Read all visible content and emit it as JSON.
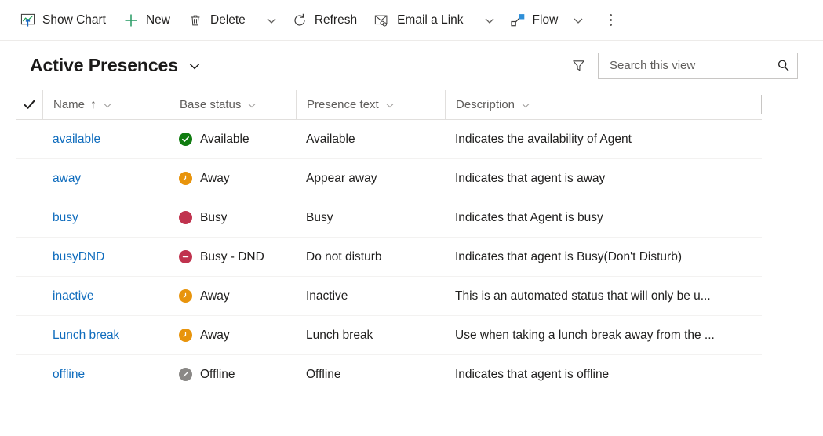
{
  "commandbar": {
    "items": [
      {
        "label": "Show Chart",
        "icon": "show-chart-icon"
      },
      {
        "label": "New",
        "icon": "plus-icon"
      },
      {
        "label": "Delete",
        "icon": "trash-icon"
      },
      {
        "label": "Refresh",
        "icon": "refresh-icon"
      },
      {
        "label": "Email a Link",
        "icon": "email-link-icon"
      },
      {
        "label": "Flow",
        "icon": "flow-icon"
      }
    ],
    "overflow_label": "More commands"
  },
  "view": {
    "title": "Active Presences",
    "title_chevron": "chevron-down-icon",
    "filter_icon": "filter-icon",
    "search": {
      "placeholder": "Search this view",
      "value": "",
      "icon": "search-icon"
    }
  },
  "grid": {
    "select_all_icon": "checkmark-icon",
    "columns": [
      {
        "label": "Name",
        "sorted": true,
        "sort_glyph": "↑"
      },
      {
        "label": "Base status",
        "sorted": false,
        "sort_glyph": ""
      },
      {
        "label": "Presence text",
        "sorted": false,
        "sort_glyph": ""
      },
      {
        "label": "Description",
        "sorted": false,
        "sort_glyph": ""
      }
    ],
    "rows": [
      {
        "name": "available",
        "base_status": "Available",
        "status_icon": "available-check-icon",
        "status_color": "#107c10",
        "presence_text": "Available",
        "description": "Indicates the availability of Agent"
      },
      {
        "name": "away",
        "base_status": "Away",
        "status_icon": "away-clock-icon",
        "status_color": "#e8940c",
        "presence_text": "Appear away",
        "description": "Indicates that agent is away"
      },
      {
        "name": "busy",
        "base_status": "Busy",
        "status_icon": "busy-filled-circle-icon",
        "status_color": "#c0334e",
        "presence_text": "Busy",
        "description": "Indicates that Agent is busy"
      },
      {
        "name": "busyDND",
        "base_status": "Busy - DND",
        "status_icon": "dnd-minus-icon",
        "status_color": "#c0334e",
        "presence_text": "Do not disturb",
        "description": "Indicates that agent is Busy(Don't Disturb)"
      },
      {
        "name": "inactive",
        "base_status": "Away",
        "status_icon": "away-clock-icon",
        "status_color": "#e8940c",
        "presence_text": "Inactive",
        "description": "This is an automated status that will only be u..."
      },
      {
        "name": "Lunch break",
        "base_status": "Away",
        "status_icon": "away-clock-icon",
        "status_color": "#e8940c",
        "presence_text": "Lunch break",
        "description": "Use when taking a lunch break away from the ..."
      },
      {
        "name": "offline",
        "base_status": "Offline",
        "status_icon": "offline-slash-icon",
        "status_color": "#8a8886",
        "presence_text": "Offline",
        "description": "Indicates that agent is offline"
      }
    ]
  },
  "colors": {
    "link": "#0f6cbd",
    "available": "#107c10",
    "away": "#e8940c",
    "busy": "#c0334e",
    "offline": "#8a8886",
    "header_text": "#605e5c",
    "divider": "#e1dfdd"
  }
}
